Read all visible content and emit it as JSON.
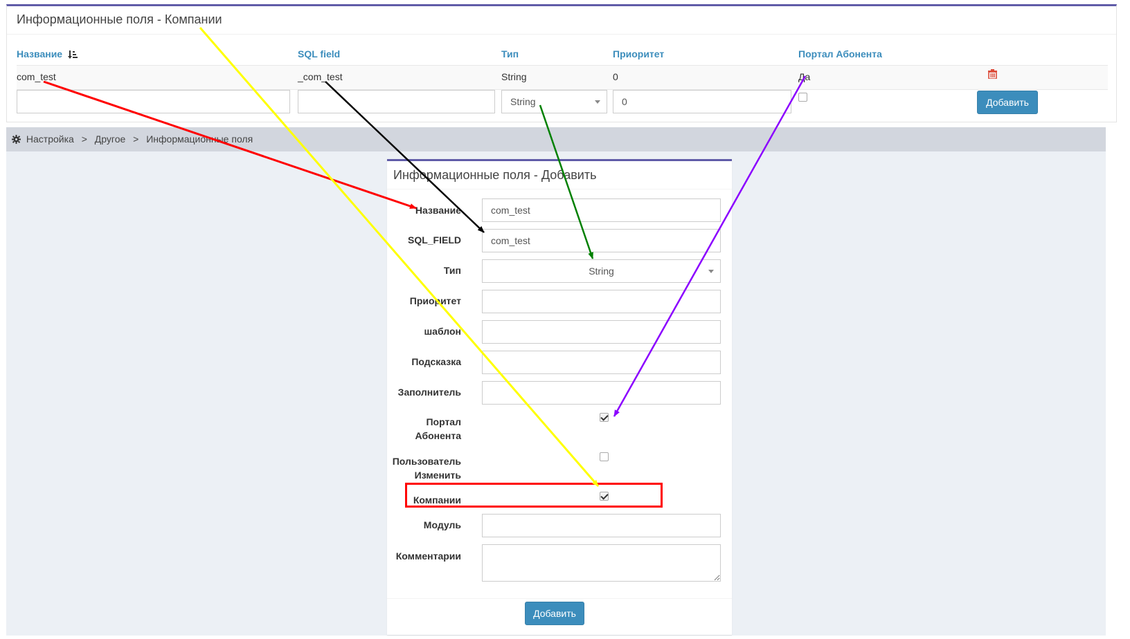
{
  "top_panel": {
    "title": "Информационные поля - Компании",
    "headers": [
      "Название",
      "SQL field",
      "Тип",
      "Приоритет",
      "Портал Абонента"
    ],
    "row": {
      "name": "com_test",
      "sql_field": "_com_test",
      "type": "String",
      "priority": "0",
      "portal": "Да"
    },
    "new_row": {
      "type_selected": "String",
      "priority_value": "0"
    },
    "add_label": "Добавить"
  },
  "breadcrumb": {
    "items": [
      "Настройка",
      "Другое",
      "Информационные поля"
    ],
    "separator": ">"
  },
  "form": {
    "title": "Информационные поля - Добавить",
    "labels": {
      "name": "Название",
      "sql_field": "SQL_FIELD",
      "type": "Тип",
      "priority": "Приоритет",
      "template": "шаблон",
      "hint": "Подсказка",
      "filler": "Заполнитель",
      "portal_1": "Портал",
      "portal_2": "Абонента",
      "user_edit_1": "Пользователь",
      "user_edit_2": "Изменить",
      "companies": "Компании",
      "module": "Модуль",
      "comments": "Комментарии"
    },
    "values": {
      "name": "com_test",
      "sql_field": "com_test",
      "type": "String"
    },
    "checkboxes": {
      "portal": true,
      "user_edit": false,
      "companies": true
    },
    "add_label": "Добавить"
  },
  "colors": {
    "accent": "#3c8dbc",
    "box_border": "#605ca8",
    "highlight": "#ff0000"
  },
  "annotation_arrows": [
    {
      "color": "#ff0000"
    },
    {
      "color": "#000000"
    },
    {
      "color": "#008000"
    },
    {
      "color": "#8b00ff"
    },
    {
      "color": "#ffff00"
    }
  ]
}
